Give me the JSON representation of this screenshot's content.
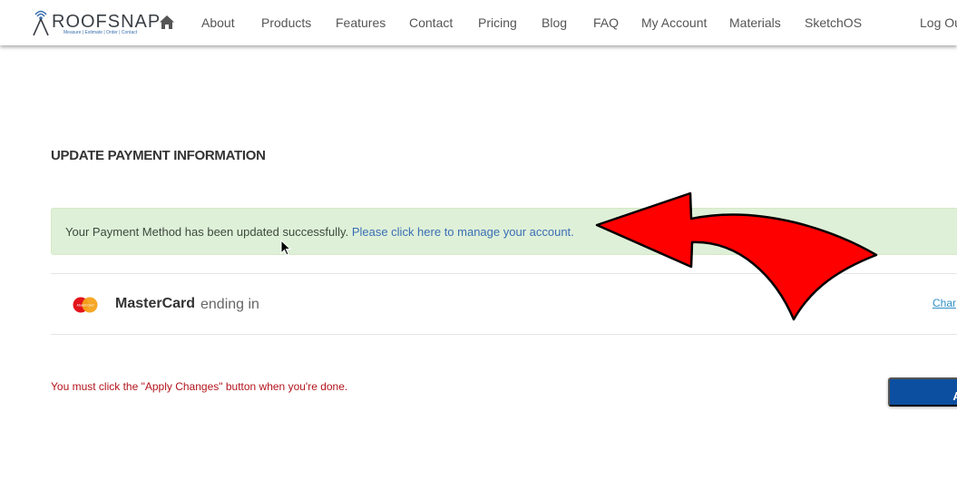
{
  "brand": {
    "name": "ROOFSNAP",
    "tagline": "Measure | Estimate | Order | Contact"
  },
  "nav": {
    "items": [
      {
        "id": "about",
        "label": "About"
      },
      {
        "id": "products",
        "label": "Products"
      },
      {
        "id": "features",
        "label": "Features"
      },
      {
        "id": "contact",
        "label": "Contact"
      },
      {
        "id": "pricing",
        "label": "Pricing"
      },
      {
        "id": "blog",
        "label": "Blog"
      },
      {
        "id": "faq",
        "label": "FAQ"
      },
      {
        "id": "my-account",
        "label": "My Account"
      },
      {
        "id": "materials",
        "label": "Materials"
      },
      {
        "id": "sketchos",
        "label": "SketchOS"
      },
      {
        "id": "logout",
        "label": "Log Ou"
      }
    ]
  },
  "page": {
    "title": "UPDATE PAYMENT INFORMATION"
  },
  "alert": {
    "message": "Your Payment Method has been updated successfully. ",
    "link_text": "Please click here to manage your account."
  },
  "payment": {
    "card_logo_text": "MasterCard",
    "card_brand": "MasterCard",
    "card_suffix": "ending in",
    "change_link": "Char"
  },
  "notice": {
    "text": "You must click the \"Apply Changes\" button when you're done."
  },
  "actions": {
    "apply_label": "Ap"
  },
  "colors": {
    "alert_bg": "#dff0d8",
    "link": "#3a6fb5",
    "notice": "#b3141c",
    "apply_button": "#0c4fa0",
    "annotation_arrow": "#ff0000"
  }
}
